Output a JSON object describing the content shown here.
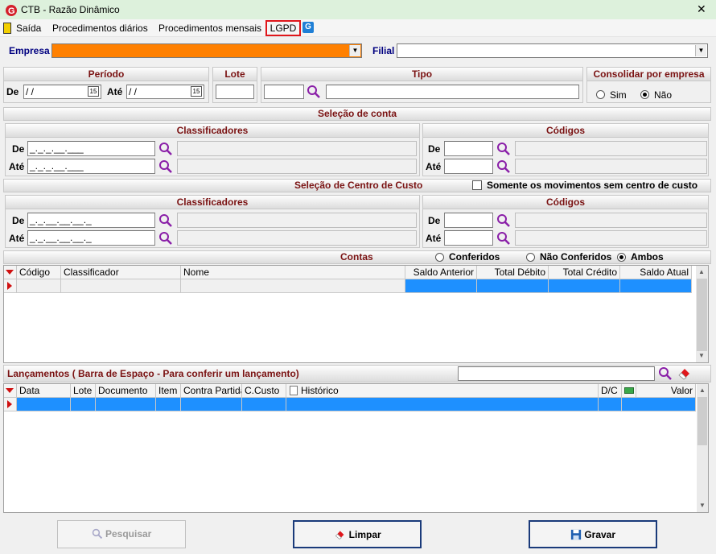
{
  "window": {
    "title": "CTB - Razão Dinâmico",
    "close": "✕"
  },
  "menu": {
    "items": [
      "Saída",
      "Procedimentos diários",
      "Procedimentos mensais",
      "LGPD"
    ],
    "g_icon": "G"
  },
  "empresa": {
    "label": "Empresa",
    "value": "",
    "color": "#ff8000"
  },
  "filial": {
    "label": "Filial",
    "value": ""
  },
  "periodo": {
    "title": "Período",
    "de_label": "De",
    "de_value": " / /",
    "ate_label": "Até",
    "ate_value": " / /",
    "cal_text": "15"
  },
  "lote": {
    "title": "Lote",
    "value": ""
  },
  "tipo": {
    "title": "Tipo",
    "code": "",
    "desc": ""
  },
  "consolidar": {
    "title": "Consolidar por empresa",
    "sim": "Sim",
    "nao": "Não",
    "selected": "Não"
  },
  "selecao_conta": {
    "title": "Seleção de conta",
    "classificadores": {
      "title": "Classificadores",
      "de_label": "De",
      "de_value": "_._._.__.___",
      "ate_label": "Até",
      "ate_value": "_._._.__.___"
    },
    "codigos": {
      "title": "Códigos",
      "de_label": "De",
      "ate_label": "Até"
    }
  },
  "selecao_centro": {
    "title": "Seleção de Centro de Custo",
    "somente_label": "Somente os movimentos sem centro de custo",
    "classificadores": {
      "title": "Classificadores",
      "de_label": "De",
      "de_value": "_._.__.__.__._",
      "ate_label": "Até",
      "ate_value": "_._.__.__.__._"
    },
    "codigos": {
      "title": "Códigos",
      "de_label": "De",
      "ate_label": "Até"
    }
  },
  "contas": {
    "title": "Contas",
    "filter": {
      "conferidos": "Conferidos",
      "nao_conferidos": "Não Conferidos",
      "ambos": "Ambos",
      "selected": "Ambos"
    },
    "columns": [
      "Código",
      "Classificador",
      "Nome",
      "Saldo Anterior",
      "Total Débito",
      "Total Crédito",
      "Saldo Atual"
    ]
  },
  "lancamentos": {
    "title": "Lançamentos ( Barra de Espaço - Para conferir um lançamento)",
    "search_value": "",
    "columns": [
      "Data",
      "Lote",
      "Documento",
      "Item",
      "Contra Partida",
      "C.Custo",
      "Histórico",
      "D/C",
      "",
      "Valor"
    ]
  },
  "buttons": {
    "pesquisar": "Pesquisar",
    "limpar": "Limpar",
    "gravar": "Gravar"
  },
  "colors": {
    "accent": "#7a1212",
    "selection": "#1e90ff",
    "lgpd_border": "#e0161b"
  }
}
